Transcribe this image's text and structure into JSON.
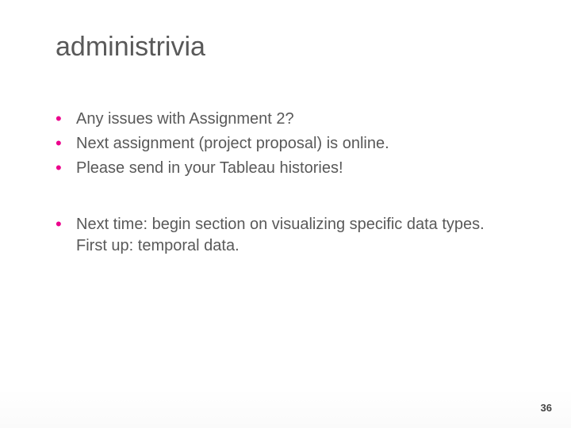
{
  "slide": {
    "title": "administrivia",
    "bullets": [
      "Any issues with Assignment 2?",
      "Next assignment (project proposal) is online.",
      "Please send in your Tableau histories!",
      "",
      "Next time: begin section on visualizing specific data types. First up: temporal data."
    ],
    "page_number": "36"
  },
  "colors": {
    "bullet_dot": "#ec008c",
    "text": "#595959"
  }
}
